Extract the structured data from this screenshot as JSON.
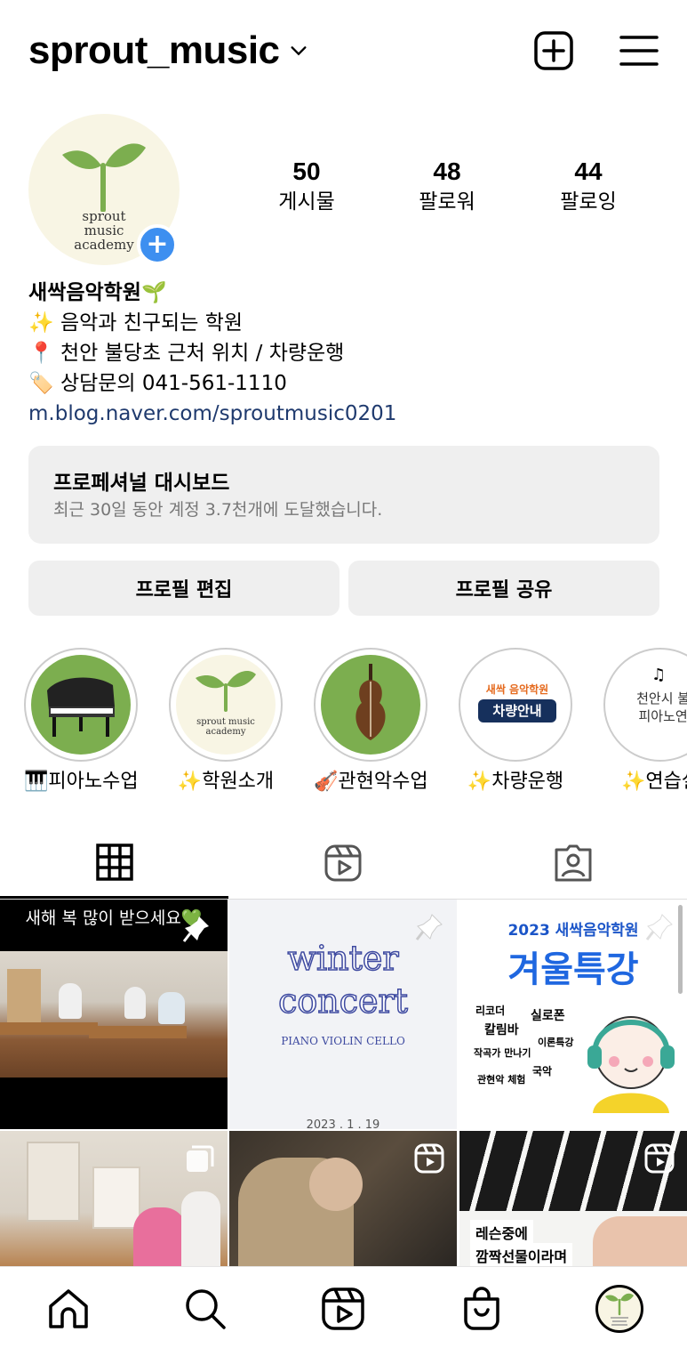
{
  "header": {
    "username": "sprout_music",
    "icons": [
      "chevron-down-icon",
      "add-post-icon",
      "menu-icon"
    ]
  },
  "profile": {
    "logo_lines": [
      "sprout",
      "music",
      "academy"
    ],
    "stats": [
      {
        "value": "50",
        "label": "게시물"
      },
      {
        "value": "48",
        "label": "팔로워"
      },
      {
        "value": "44",
        "label": "팔로잉"
      }
    ],
    "name": "새싹음악학원🌱",
    "bio_lines": [
      "✨ 음악과 친구되는 학원",
      "📍 천안 불당초 근처 위치 / 차량운행",
      "🏷️ 상담문의 041-561-1110"
    ],
    "link": "m.blog.naver.com/sproutmusic0201"
  },
  "dashboard": {
    "title": "프로페셔널 대시보드",
    "subtitle": "최근 30일 동안 계정 3.7천개에 도달했습니다."
  },
  "buttons": {
    "edit": "프로필 편집",
    "share": "프로필 공유"
  },
  "highlights": [
    {
      "label": "🎹피아노수업"
    },
    {
      "label": "✨학원소개",
      "logo": "sprout music academy"
    },
    {
      "label": "🎻관현악수업"
    },
    {
      "label": "✨차량운행",
      "badge_title": "새싹 음악학원",
      "badge_sub": "차량안내"
    },
    {
      "label": "✨연습실",
      "text_lines": [
        "천안시 불당",
        "피아노연습"
      ]
    }
  ],
  "posts": [
    {
      "caption": "새해 복 많이 받으세요💚"
    },
    {
      "title_1": "winter",
      "title_2": "concert",
      "sub": "PIANO  VIOLIN  CELLO",
      "date": "2023 . 1 . 19"
    },
    {
      "year_title": "2023 새싹음악학원",
      "title": "겨울특강",
      "items": [
        "리코더",
        "실로폰",
        "칼림바",
        "이론특강",
        "작곡가 만나기",
        "국악",
        "관현악 체험"
      ]
    },
    {
      "caption": ""
    },
    {
      "caption": ""
    },
    {
      "caption_lines": [
        "레슨중에",
        "깜짝선물이라며"
      ]
    }
  ],
  "colors": {
    "accent": "#3d8ff0",
    "link": "#1f3a6e",
    "button_bg": "#efefef",
    "logo_green": "#7cae4f"
  }
}
